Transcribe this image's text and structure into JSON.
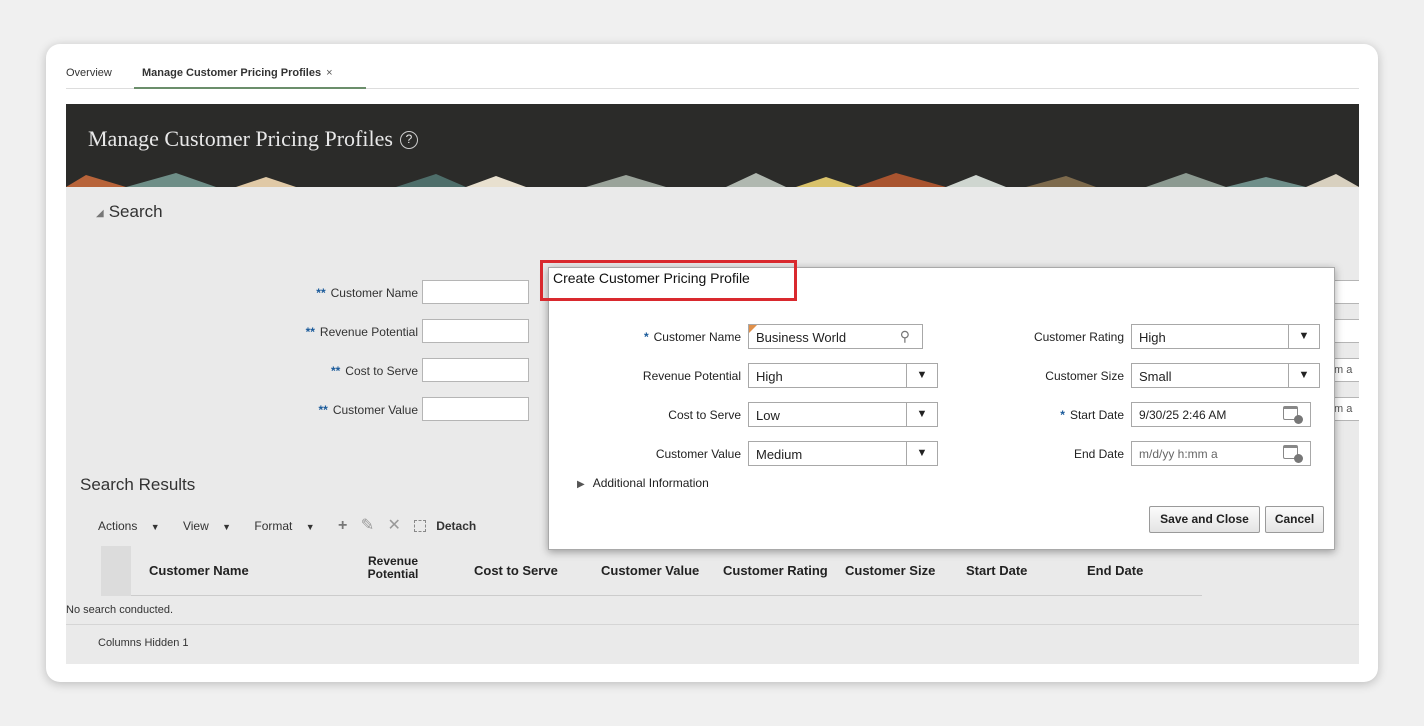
{
  "tabs": {
    "overview": "Overview",
    "active": "Manage Customer Pricing Profiles",
    "close": "×"
  },
  "page": {
    "title": "Manage Customer Pricing Profiles",
    "help": "?"
  },
  "search": {
    "header": "Search",
    "required_mark": "**",
    "fields": {
      "customer_name": "Customer Name",
      "revenue_potential": "Revenue Potential",
      "cost_to_serve": "Cost to Serve",
      "customer_value": "Customer Value"
    },
    "cut_text": "m a"
  },
  "results": {
    "header": "Search Results",
    "toolbar": {
      "actions": "Actions",
      "view": "View",
      "format": "Format",
      "detach": "Detach"
    },
    "columns": {
      "customer_name": "Customer Name",
      "revenue_potential_1": "Revenue",
      "revenue_potential_2": "Potential",
      "cost_to_serve": "Cost to Serve",
      "customer_value": "Customer Value",
      "customer_rating": "Customer Rating",
      "customer_size": "Customer Size",
      "start_date": "Start Date",
      "end_date": "End Date"
    },
    "empty_message": "No search conducted.",
    "columns_hidden": "Columns Hidden  1"
  },
  "dialog": {
    "title": "Create Customer Pricing Profile",
    "required_mark": "*",
    "customer_name": {
      "label": "Customer Name",
      "value": "Business World"
    },
    "revenue_potential": {
      "label": "Revenue Potential",
      "value": "High"
    },
    "cost_to_serve": {
      "label": "Cost to Serve",
      "value": "Low"
    },
    "customer_value": {
      "label": "Customer Value",
      "value": "Medium"
    },
    "customer_rating": {
      "label": "Customer Rating",
      "value": "High"
    },
    "customer_size": {
      "label": "Customer Size",
      "value": "Small"
    },
    "start_date": {
      "label": "Start Date",
      "value": "9/30/25 2:46 AM"
    },
    "end_date": {
      "label": "End Date",
      "placeholder": "m/d/yy h:mm a"
    },
    "additional_info": "Additional Information",
    "save_close": "Save and Close",
    "cancel": "Cancel"
  },
  "colors": {
    "banner": "#2b2b29",
    "highlight": "#d9292e",
    "required": "#1a5a9a"
  }
}
